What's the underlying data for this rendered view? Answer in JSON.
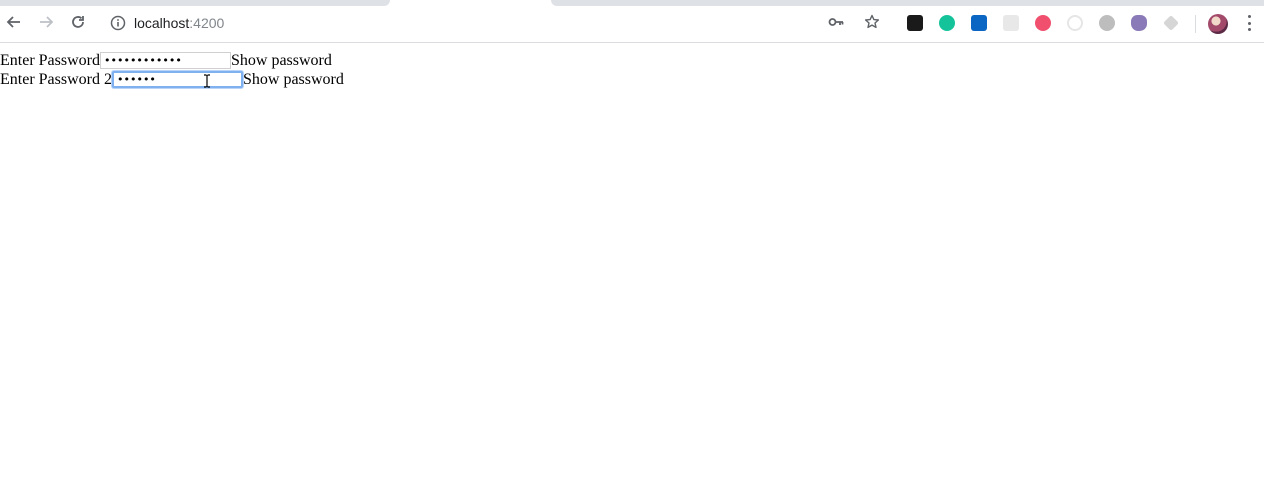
{
  "browser": {
    "url_host": "localhost",
    "url_port": ":4200",
    "icons": {
      "back": "arrow-left-icon",
      "forward": "arrow-right-icon",
      "reload": "reload-icon",
      "site_info": "info-icon",
      "password_key": "key-icon",
      "bookmark": "star-icon",
      "menu": "more-vert-icon"
    },
    "extensions": [
      {
        "name": "ext-dark-app-icon",
        "color": "#1a1a1a"
      },
      {
        "name": "ext-grammarly-icon",
        "color": "#15c39a"
      },
      {
        "name": "ext-linkedin-icon",
        "color": "#0a66c2"
      },
      {
        "name": "ext-generic-icon",
        "color": "#e8e8e8"
      },
      {
        "name": "ext-pink-icon",
        "color": "#f0506e"
      },
      {
        "name": "ext-circle-icon",
        "color": "#e6e6e6"
      },
      {
        "name": "ext-gray-icon",
        "color": "#bdbdbd"
      },
      {
        "name": "ext-github-cat-icon",
        "color": "#8a7ab8"
      },
      {
        "name": "ext-diamond-icon",
        "color": "#d6d6d6"
      }
    ]
  },
  "form": {
    "row1": {
      "label": "Enter Password",
      "value": "••••••••••••",
      "toggle_label": "Show password"
    },
    "row2": {
      "label": "Enter Password 2",
      "value": "••••••",
      "toggle_label": "Show password"
    }
  },
  "colors": {
    "focus_ring": "#7fb0f0",
    "chrome_border": "#dadce0"
  }
}
